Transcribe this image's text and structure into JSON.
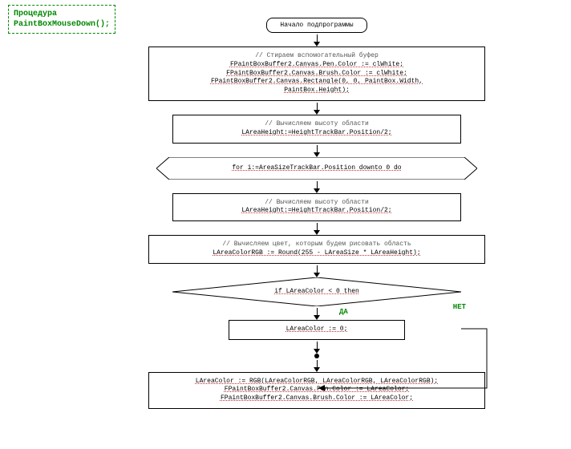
{
  "procedure": {
    "line1": "Процедура",
    "line2": "PaintBoxMouseDown();"
  },
  "flow": {
    "start": "Начало подпрограммы",
    "n1": {
      "c": "// Стираем вспомогательный буфер",
      "l1": "FPaintBoxBuffer2.Canvas.Pen.Color := clWhite;",
      "l2": "FPaintBoxBuffer2.Canvas.Brush.Color := clWhite;",
      "l3": "FPaintBoxBuffer2.Canvas.Rectangle(0, 0, PaintBox.Width,",
      "l4": "PaintBox.Height);"
    },
    "n2": {
      "c": "// Вычисляем высоту области",
      "l1": "LAreaHeight:=HeightTrackBar.Position/2;"
    },
    "loop": "for i:=AreaSizeTrackBar.Position downto 0 do",
    "n3": {
      "c": "// Вычисляем высоту области",
      "l1": "LAreaHeight:=HeightTrackBar.Position/2;"
    },
    "n4": {
      "c": "// Вычисляем цвет, которым будем рисовать область",
      "l1": "LAreaColorRGB := Round(255 - LAreaSize * LAreaHeight);"
    },
    "decision": "if LAreaColor < 0 then",
    "yes": "ДА",
    "no": "НЕТ",
    "n5": "LAreaColor := 0;",
    "n6": {
      "l1": "LAreaColor := RGB(LAreaColorRGB, LAreaColorRGB, LAreaColorRGB);",
      "l2": "FPaintBoxBuffer2.Canvas.Pen.Color := LAreaColor;",
      "l3": "FPaintBoxBuffer2.Canvas.Brush.Color := LAreaColor;"
    }
  }
}
